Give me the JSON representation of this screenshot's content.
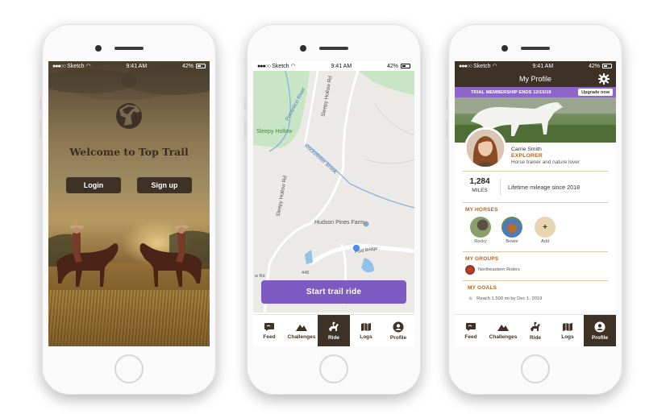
{
  "status_bar": {
    "carrier": "Sketch",
    "signal": "●●●○○",
    "time": "9:41 AM",
    "battery": "42%"
  },
  "welcome": {
    "title": "Welcome to Top Trail",
    "login_label": "Login",
    "signup_label": "Sign up"
  },
  "map": {
    "labels": {
      "pocantico": "Pocantico River",
      "sleepy_hollow": "Sleepy Hollow",
      "sleepy_hollow_rd_top": "Sleepy Hollow Rd",
      "rockefeller_brook": "Rockefeller Brook",
      "sleepy_hollow_rd_left": "Sleepy Hollow Rd",
      "hudson_pines": "Hudson Pines Farm",
      "ford_bridge": "Ford Bridge",
      "road_number": "448",
      "rd_fragment": "w Rd"
    },
    "start_label": "Start trail ride"
  },
  "tabs": [
    {
      "label": "Feed",
      "icon": "chat-bubble-icon"
    },
    {
      "label": "Challenges",
      "icon": "mountains-icon"
    },
    {
      "label": "Ride",
      "icon": "horse-rider-icon"
    },
    {
      "label": "Logs",
      "icon": "map-book-icon"
    },
    {
      "label": "Profile",
      "icon": "profile-icon"
    }
  ],
  "profile": {
    "header_title": "My Profile",
    "trial_text": "TRIAL MEMBERSHIP ENDS 12/15/19",
    "upgrade_label": "Upgrade now",
    "name": "Carrie Smith",
    "role": "EXPLORER",
    "bio": "Horse trainer and nature lover",
    "miles_value": "1,284",
    "miles_unit": "MILES",
    "miles_caption": "Lifetime mileage since 2018",
    "horses_title": "MY HORSES",
    "horses": [
      {
        "name": "Rocky"
      },
      {
        "name": "Bowie"
      }
    ],
    "add_symbol": "+",
    "add_label": "Add",
    "groups_title": "MY GROUPS",
    "group_name": "Northeastern Riders",
    "goals_title": "MY GOALS",
    "goal_text": "Reach 1,500 mi by Dec 1, 2019"
  },
  "colors": {
    "brand_brown": "#3e3226",
    "accent_purple": "#7e5bc2",
    "section_orange": "#b5651d"
  }
}
